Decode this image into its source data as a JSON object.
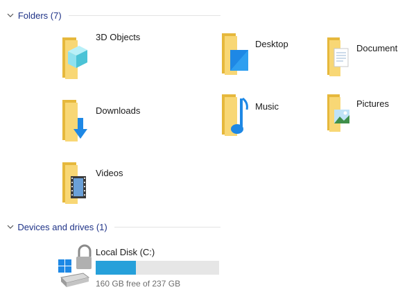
{
  "groups": {
    "folders": {
      "title": "Folders (7)"
    },
    "devices": {
      "title": "Devices and drives (1)"
    }
  },
  "folders": [
    {
      "label": "3D Objects",
      "icon": "3d-objects-folder-icon"
    },
    {
      "label": "Desktop",
      "icon": "desktop-folder-icon"
    },
    {
      "label": "Documents",
      "icon": "documents-folder-icon"
    },
    {
      "label": "Downloads",
      "icon": "downloads-folder-icon"
    },
    {
      "label": "Music",
      "icon": "music-folder-icon"
    },
    {
      "label": "Pictures",
      "icon": "pictures-folder-icon"
    },
    {
      "label": "Videos",
      "icon": "videos-folder-icon"
    }
  ],
  "drive": {
    "label": "Local Disk (C:)",
    "free_text": "160 GB free of 237 GB",
    "used_fraction": 0.325,
    "bar_color": "#26a0da",
    "icon": "local-disk-icon"
  },
  "colors": {
    "group_title": "#1e3287",
    "folder_back": "#e6b83c",
    "folder_front": "#f8d775"
  }
}
